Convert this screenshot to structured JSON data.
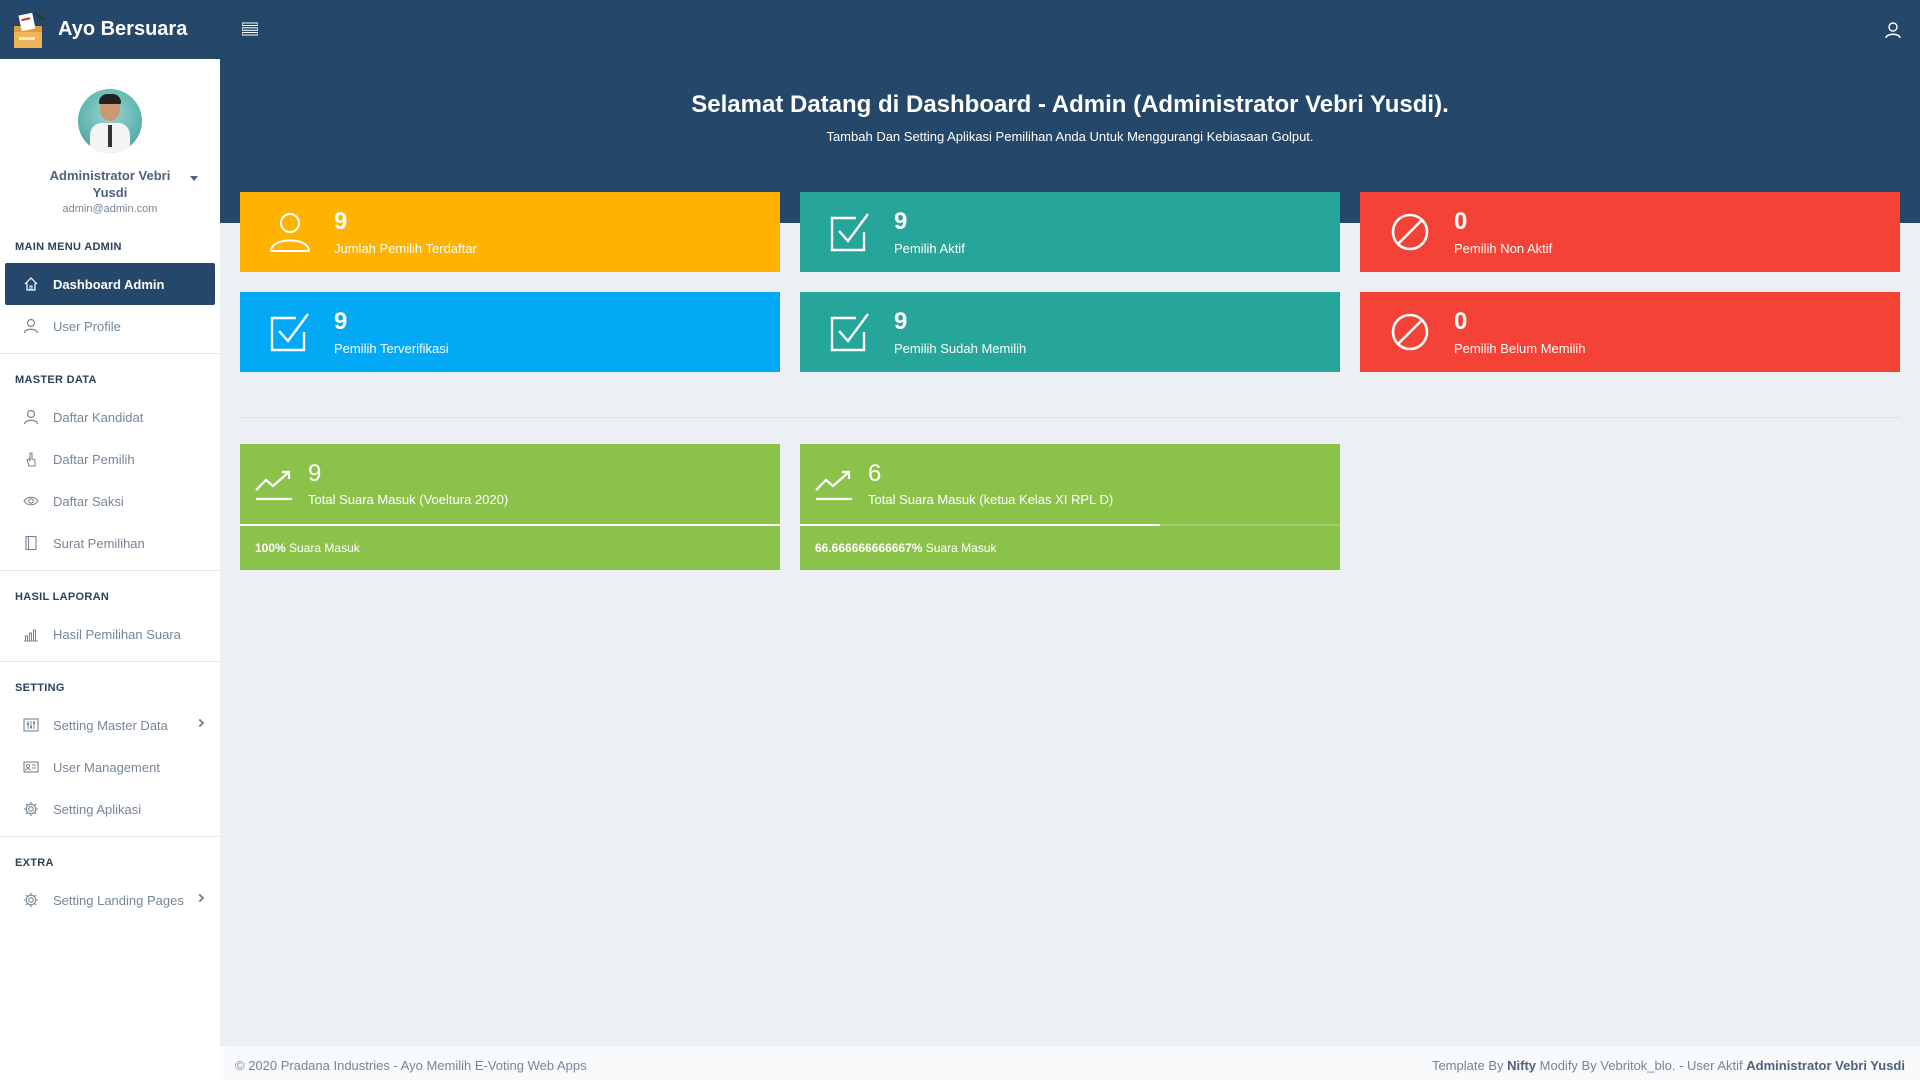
{
  "brand": {
    "title": "Ayo Bersuara",
    "logo_icon": "ballot-box-icon"
  },
  "topbar": {
    "menu_icon": "menu-icon",
    "user_icon": "user-icon"
  },
  "profile": {
    "name": "Administrator Vebri Yusdi",
    "email": "admin@admin.com"
  },
  "sidebar": {
    "sections": [
      {
        "header": "MAIN MENU ADMIN",
        "items": [
          {
            "label": "Dashboard Admin",
            "icon": "home-icon",
            "active": true
          },
          {
            "label": "User Profile",
            "icon": "user-icon"
          }
        ]
      },
      {
        "header": "MASTER DATA",
        "items": [
          {
            "label": "Daftar Kandidat",
            "icon": "user-icon"
          },
          {
            "label": "Daftar Pemilih",
            "icon": "hand-pointer-icon"
          },
          {
            "label": "Daftar Saksi",
            "icon": "eye-icon"
          },
          {
            "label": "Surat Pemilihan",
            "icon": "book-icon"
          }
        ]
      },
      {
        "header": "HASIL LAPORAN",
        "items": [
          {
            "label": "Hasil Pemilihan Suara",
            "icon": "bar-chart-icon"
          }
        ]
      },
      {
        "header": "SETTING",
        "items": [
          {
            "label": "Setting Master Data",
            "icon": "sliders-icon",
            "has_arrow": true
          },
          {
            "label": "User Management",
            "icon": "id-card-icon"
          },
          {
            "label": "Setting Aplikasi",
            "icon": "gear-icon"
          }
        ]
      },
      {
        "header": "EXTRA",
        "items": [
          {
            "label": "Setting Landing Pages",
            "icon": "gear-icon",
            "has_arrow": true
          }
        ]
      }
    ]
  },
  "hero": {
    "title": "Selamat Datang di Dashboard - Admin (Administrator Vebri Yusdi).",
    "subtitle": "Tambah Dan Setting Aplikasi Pemilihan Anda Untuk Menggurangi Kebiasaan Golput."
  },
  "stats": [
    {
      "value": "9",
      "label": "Jumlah Pemilih Terdaftar",
      "icon": "user-icon",
      "color": "#ffb300"
    },
    {
      "value": "9",
      "label": "Pemilih Aktif",
      "icon": "checkbox-icon",
      "color": "#26a69a"
    },
    {
      "value": "0",
      "label": "Pemilih Non Aktif",
      "icon": "ban-icon",
      "color": "#f44336"
    },
    {
      "value": "9",
      "label": "Pemilih Terverifikasi",
      "icon": "checkbox-icon",
      "color": "#03a9f4"
    },
    {
      "value": "9",
      "label": "Pemilih Sudah Memilih",
      "icon": "checkbox-icon",
      "color": "#26a69a"
    },
    {
      "value": "0",
      "label": "Pemilih Belum Memilih",
      "icon": "ban-icon",
      "color": "#f44336"
    }
  ],
  "votes": [
    {
      "value": "9",
      "label": "Total Suara Masuk (Voeltura 2020)",
      "percent": "100%",
      "fill_fraction": 1.0,
      "foot_suffix": "Suara Masuk",
      "icon": "trend-up-icon",
      "color": "#8bc34a"
    },
    {
      "value": "6",
      "label": "Total Suara Masuk (ketua Kelas XI RPL D)",
      "percent": "66.666666666667%",
      "fill_fraction": 0.6667,
      "foot_suffix": "Suara Masuk",
      "icon": "trend-up-icon",
      "color": "#8bc34a"
    }
  ],
  "footer": {
    "left": "© 2020 Pradana Industries - Ayo Memilih E-Voting Web Apps",
    "right_prefix": "Template By",
    "right_template": "Nifty",
    "right_middle": "Modify By Vebritok_blo. - User Aktif",
    "right_user": "Administrator Vebri Yusdi"
  }
}
